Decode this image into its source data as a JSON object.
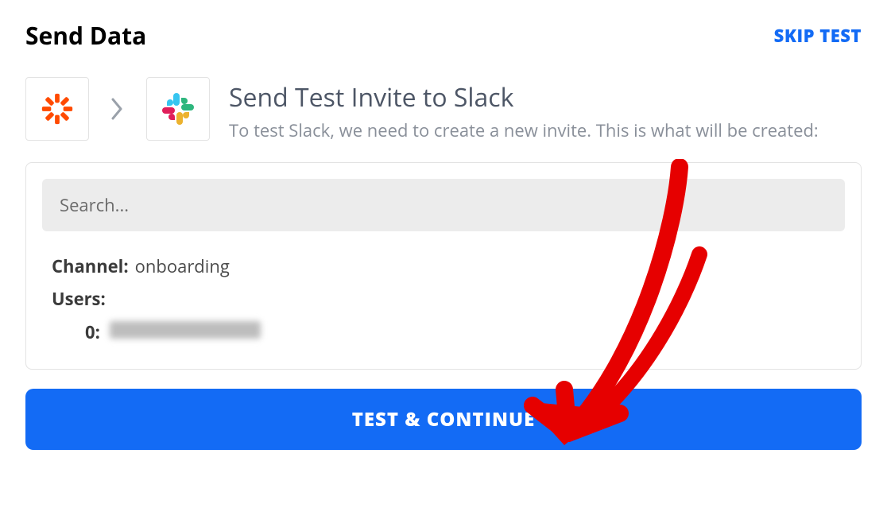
{
  "header": {
    "title": "Send Data",
    "skip_label": "SKIP TEST"
  },
  "action": {
    "source_icon": "zapier",
    "target_icon": "slack",
    "heading": "Send Test Invite to Slack",
    "description": "To test Slack, we need to create a new invite. This is what will be created:"
  },
  "search": {
    "placeholder": "Search..."
  },
  "preview": {
    "channel_label": "Channel:",
    "channel_value": "onboarding",
    "users_label": "Users:",
    "user_index_label": "0:",
    "user_value_redacted": true
  },
  "cta": {
    "label": "TEST & CONTINUE"
  },
  "colors": {
    "primary": "#136bf5",
    "zapier_orange": "#ff4a00"
  }
}
